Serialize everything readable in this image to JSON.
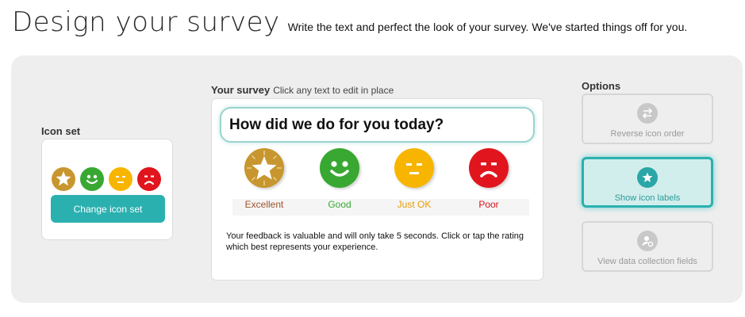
{
  "header": {
    "title": "Design your survey",
    "subtitle": "Write the text and perfect the look of your survey. We've started things off for you."
  },
  "icon_set": {
    "label": "Icon set",
    "button_label": "Change icon set",
    "mini_icons": [
      "star-icon",
      "smile-icon",
      "neutral-face-icon",
      "frown-icon"
    ]
  },
  "survey": {
    "label": "Your survey",
    "hint": "Click any text to edit in place",
    "question": "How did we do for you today?",
    "ratings": [
      {
        "label": "Excellent",
        "icon": "star-icon",
        "color": "#c8962e",
        "label_color": "#a0522d"
      },
      {
        "label": "Good",
        "icon": "smile-icon",
        "color": "#38a832",
        "label_color": "#38a832"
      },
      {
        "label": "Just OK",
        "icon": "neutral-face-icon",
        "color": "#f7b500",
        "label_color": "#e89d00"
      },
      {
        "label": "Poor",
        "icon": "frown-icon",
        "color": "#e0151d",
        "label_color": "#d8131b"
      }
    ],
    "feedback": "Your feedback is valuable and will only take 5 seconds. Click or tap the rating which best represents your experience."
  },
  "options": {
    "label": "Options",
    "items": [
      {
        "label": "Reverse icon order",
        "icon": "swap-arrows-icon",
        "active": false
      },
      {
        "label": "Show icon labels",
        "icon": "star-badge-icon",
        "active": true
      },
      {
        "label": "View data collection fields",
        "icon": "user-settings-icon",
        "active": false
      }
    ]
  },
  "colors": {
    "accent": "#2bb0b0",
    "panel_background": "#eeeeee"
  }
}
